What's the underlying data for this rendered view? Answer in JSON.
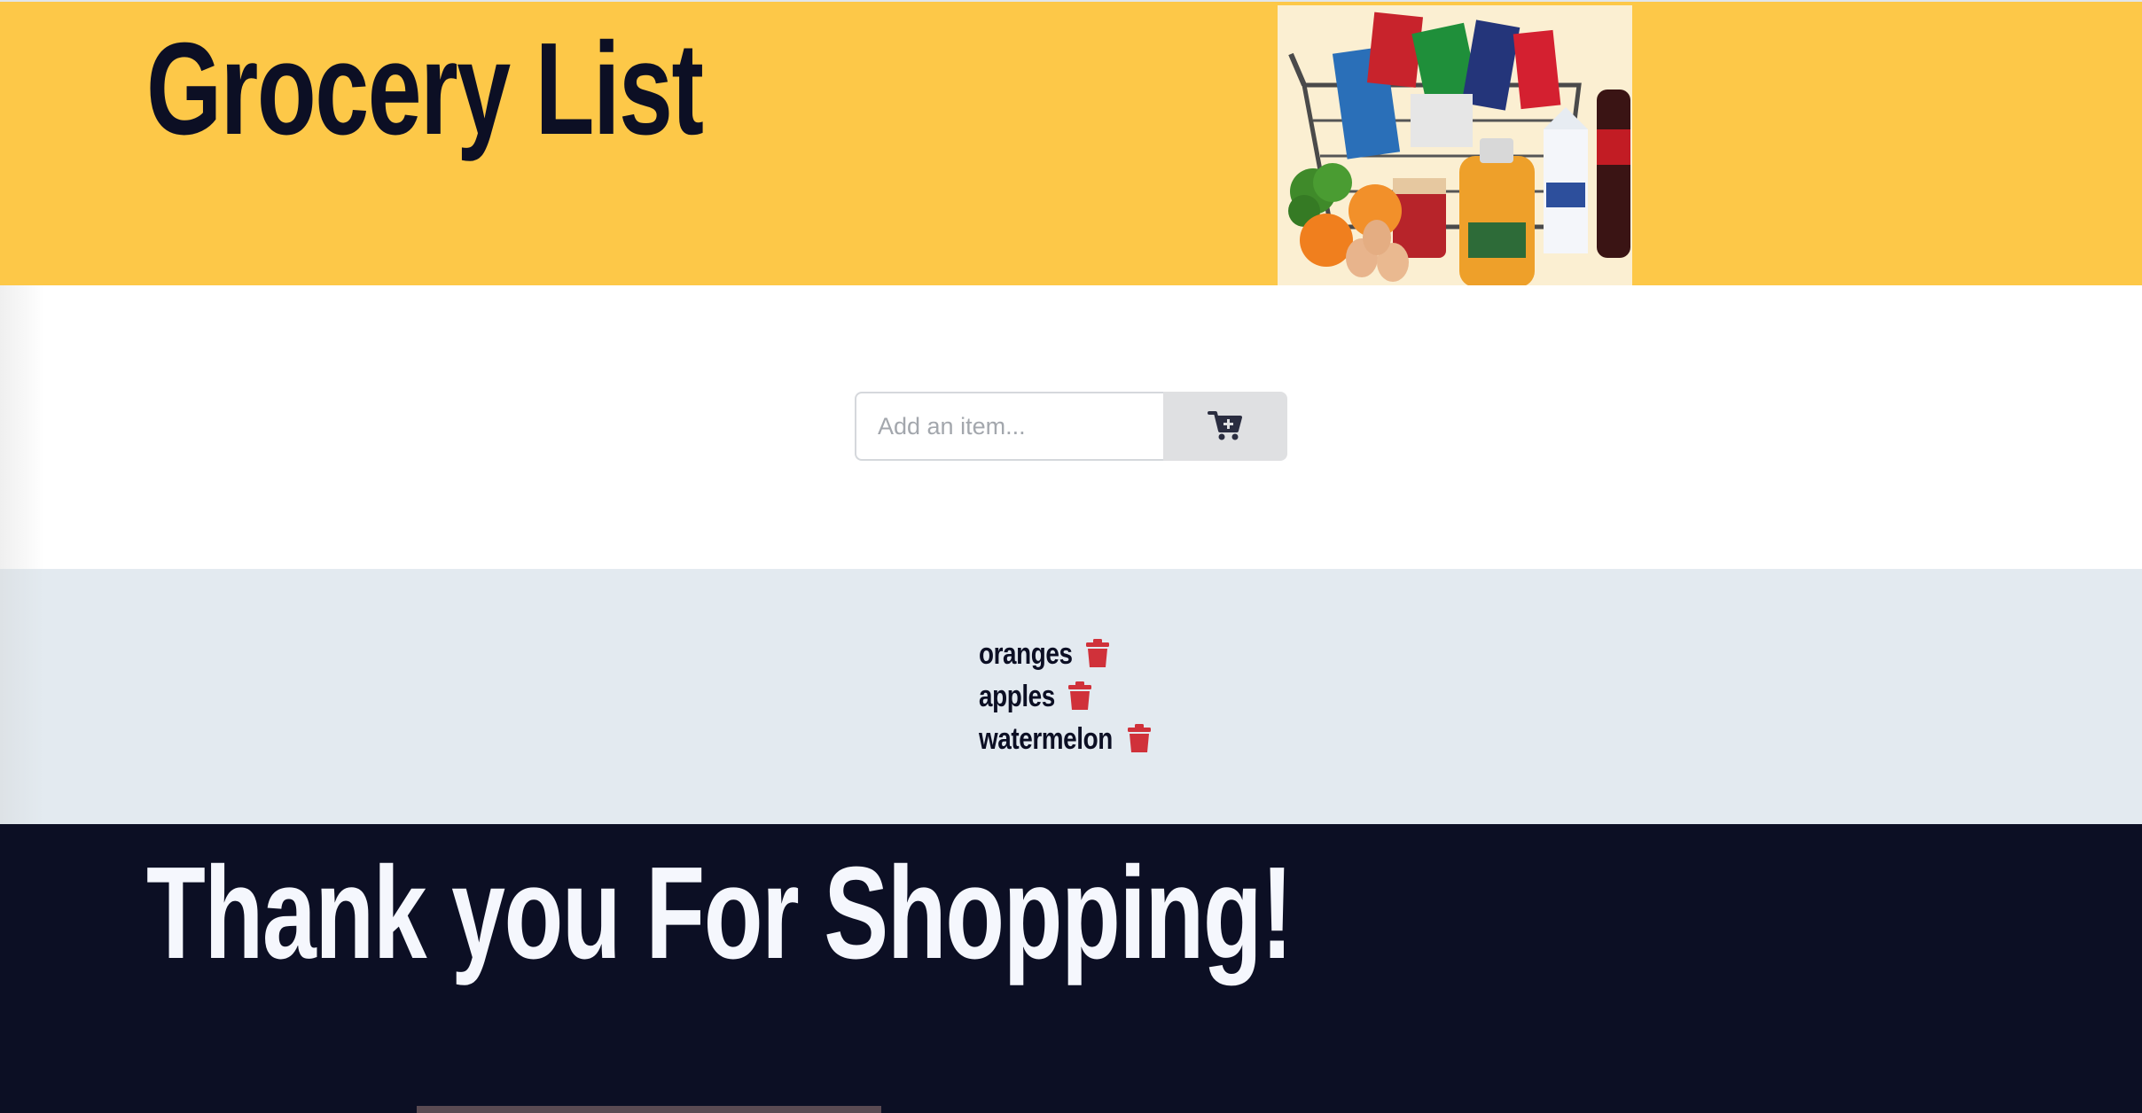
{
  "header": {
    "title": "Grocery List",
    "image_alt": "grocery-basket-image"
  },
  "form": {
    "input_placeholder": "Add an item...",
    "input_value": "",
    "add_button_icon": "cart-plus-icon"
  },
  "list": {
    "items": [
      {
        "label": "oranges",
        "delete_icon": "trash-icon"
      },
      {
        "label": "apples",
        "delete_icon": "trash-icon"
      },
      {
        "label": "watermelon",
        "delete_icon": "trash-icon"
      }
    ]
  },
  "footer": {
    "message": "Thank you For Shopping!"
  },
  "colors": {
    "header_bg": "#fdc848",
    "list_bg": "#e3eaf0",
    "footer_bg": "#0c0f24",
    "trash": "#d0313a",
    "dark_text": "#0c0f24"
  }
}
